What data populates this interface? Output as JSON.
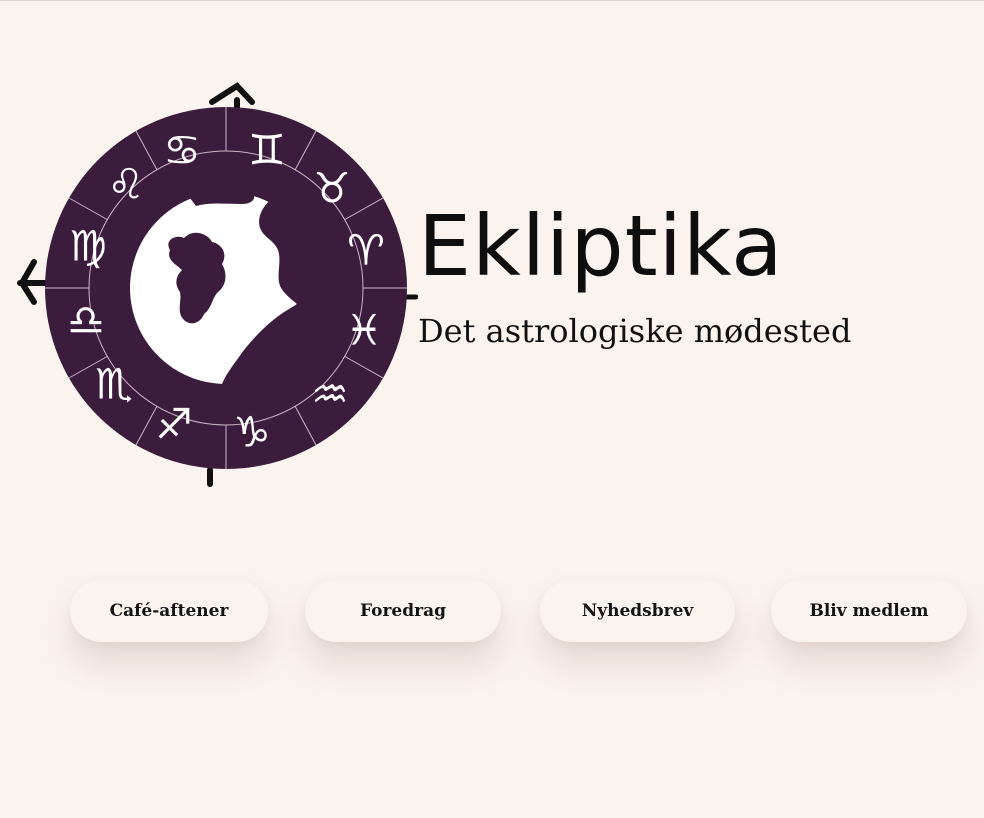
{
  "brand": {
    "title": "Ekliptika",
    "subtitle": "Det astrologiske mødested",
    "logo_icon": "zodiac-wheel-logo",
    "colors": {
      "wheel": "#3c1c3d",
      "background": "#fbf3ee",
      "text": "#141414"
    }
  },
  "nav": {
    "items": [
      {
        "label": "Café-aftener"
      },
      {
        "label": "Foredrag"
      },
      {
        "label": "Nyhedsbrev"
      },
      {
        "label": "Bliv medlem"
      }
    ]
  }
}
